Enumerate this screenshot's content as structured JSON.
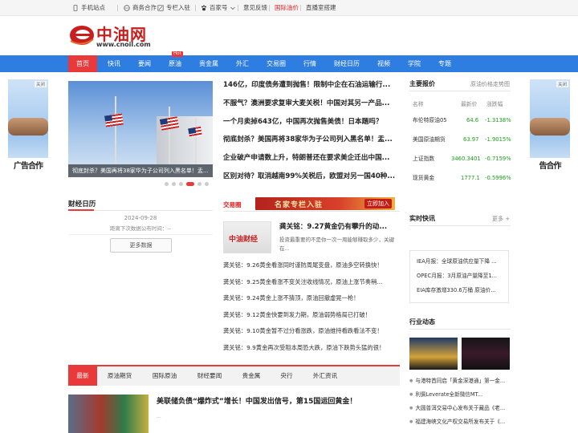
{
  "topbar": {
    "items": [
      "手机站点",
      "商务合作",
      "专栏入驻",
      "百家号",
      "意见反馈",
      "国际油价",
      "直播室搭建"
    ],
    "colors": {
      "highlight": "#e02020"
    }
  },
  "header": {
    "logo_text": "中油网",
    "logo_url": "www.cnoil.com"
  },
  "nav": {
    "items": [
      "首页",
      "快讯",
      "要闻",
      "原油",
      "贵金属",
      "外汇",
      "交易圈",
      "行情",
      "财经日历",
      "视频",
      "学院",
      "专题"
    ],
    "hot_badge": "Hot",
    "active_index": 0,
    "colors": {
      "bar": "#2e7de1",
      "active": "#e83a3a"
    }
  },
  "side_ads": {
    "caption_left": "广告合作",
    "caption_right": "告合作",
    "close_label": "关闭"
  },
  "slideshow": {
    "caption": "彻底封杀？美国再将38家华为子公司列入黑名单！盂..."
  },
  "headlines": [
    "146亿，印度债务遭到抛售！限制中企在石油运输行...",
    "不服气？澳洲要求复审大麦关税！中国对其另一产品...",
    "一个月卖掉643亿，中国再次抛售美债！日本題吗？",
    "彻底封杀？美国再将38家华为子公司列入黑名单！盂...",
    "企业破产申请数上升，特朗普还在要求美企迁出中国...",
    "区别对待？取消越南99%关税后，欧盟对另一国40种..."
  ],
  "calendar": {
    "title": "财经日历",
    "date": "2024-09-28",
    "next_text": "距离下次数据公布时间：--",
    "more_button": "更多数据"
  },
  "trading": {
    "title": "交易圈",
    "banner_text": "名家专栏入驻",
    "banner_button": "立即加入",
    "feature_logo": "中油财经",
    "feature_title": "龚关铭：9.27黄金仍有攀升的动...",
    "feature_desc": "投资最重要的不是你一次一周能够赚取多少，关键在...",
    "list": [
      "龚关铭：9.26黄金看涨同时谨防周尾变盘，原油多空转换快！",
      "龚关铭：9.25黄金看涨不变关注收线情况，原油上涨节奏稍...",
      "龚关铭：9.24黄金上涨不猜顶，原油回撤虚晃一枪！",
      "龚关铭：9.12黄金快要到发力期，原油弱势格局已打破！",
      "龚关铭：9.10黄金暂不过分看涨跌，原油维持看跌看法不变！",
      "龚关铭：9.9黄金再次受阻本周恐大跌，原油下跌势头猛的很！"
    ]
  },
  "bottom_tabs": {
    "items": [
      "最新",
      "原油期货",
      "国际原油",
      "财经要闻",
      "贵金属",
      "央行",
      "外汇资讯"
    ],
    "active_index": 0
  },
  "bottom_news": {
    "title": "美联储负债“爆炸式”增长！中国发出信号，第15国运回黄金！",
    "snippet": "..."
  },
  "quotes": {
    "title": "主要报价",
    "subtitle": "原油价格走势图",
    "headers": [
      "名称",
      "最新价",
      "涨跌幅"
    ],
    "rows": [
      {
        "name": "布伦特原油05",
        "price": "64.6",
        "change": "-1.3138%"
      },
      {
        "name": "美国原油期货",
        "price": "63.97",
        "change": "-1.9015%"
      },
      {
        "name": "上证指数",
        "price": "3460.3401",
        "change": "-0.7159%"
      },
      {
        "name": "现货黄金",
        "price": "1777.1",
        "change": "-0.5996%"
      }
    ],
    "colors": {
      "down": "#1aa01a"
    }
  },
  "flash": {
    "title": "实时快讯",
    "more": "更多 +",
    "items": [
      "IEA月报：全球原油供应量下降 ...",
      "OPEC月报：3月原油产量降至1...",
      "EIA库存激增330.6万桶 原油价..."
    ]
  },
  "industry": {
    "title": "行业动态",
    "items": [
      "与港特首同启「黄金深港通」第一金...",
      "利佩Leverate全新微信MT...",
      "大圆普洱交易中心发布关于藏品《老...",
      "福建海峡文化产权交易所发布关于《..."
    ]
  }
}
